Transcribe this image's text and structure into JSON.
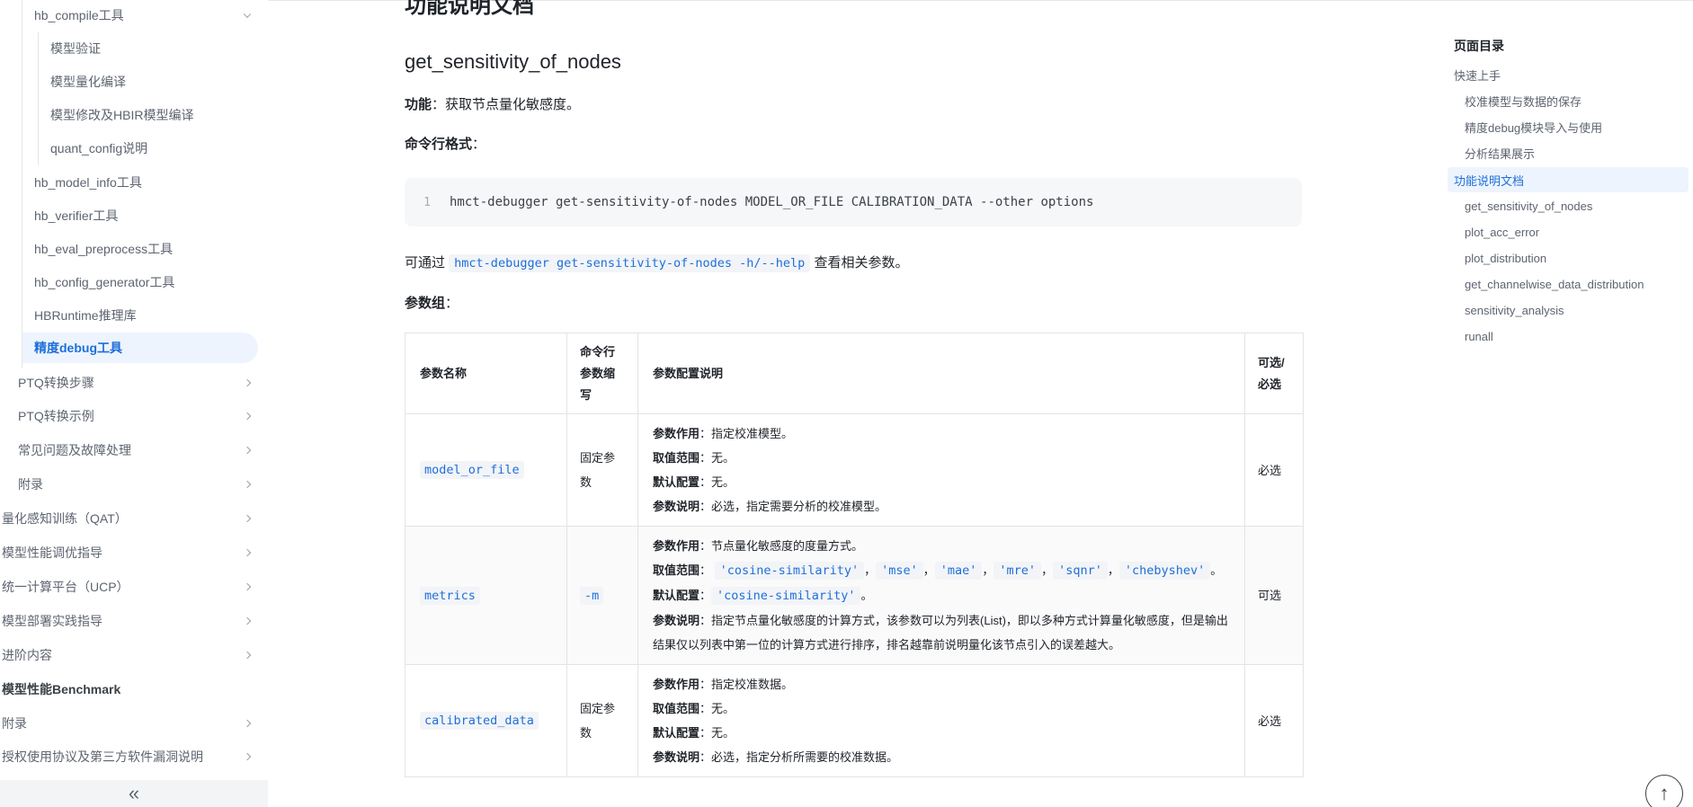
{
  "sidebar": {
    "items": [
      {
        "label": "hb_compile工具",
        "chevron": "down"
      },
      {
        "label": "模型验证"
      },
      {
        "label": "模型量化编译"
      },
      {
        "label": "模型修改及HBIR模型编译"
      },
      {
        "label": "quant_config说明"
      },
      {
        "label": "hb_model_info工具"
      },
      {
        "label": "hb_verifier工具"
      },
      {
        "label": "hb_eval_preprocess工具"
      },
      {
        "label": "hb_config_generator工具"
      },
      {
        "label": "HBRuntime推理库"
      },
      {
        "label": "精度debug工具",
        "active": true
      },
      {
        "label": "PTQ转换步骤",
        "chevron": "right"
      },
      {
        "label": "PTQ转换示例",
        "chevron": "right"
      },
      {
        "label": "常见问题及故障处理",
        "chevron": "right"
      },
      {
        "label": "附录",
        "chevron": "right"
      },
      {
        "label": "量化感知训练（QAT）",
        "chevron": "right"
      },
      {
        "label": "模型性能调优指导",
        "chevron": "right"
      },
      {
        "label": "统一计算平台（UCP）",
        "chevron": "right"
      },
      {
        "label": "模型部署实践指导",
        "chevron": "right"
      },
      {
        "label": "进阶内容",
        "chevron": "right"
      },
      {
        "label": "模型性能Benchmark"
      },
      {
        "label": "附录",
        "chevron": "right"
      },
      {
        "label": "授权使用协议及第三方软件漏洞说明",
        "chevron": "right"
      }
    ],
    "collapse_glyph": "«"
  },
  "main": {
    "cut_heading": "功能说明文档",
    "heading": "get_sensitivity_of_nodes",
    "function_label": "功能",
    "function_text": "：获取节点量化敏感度。",
    "cmd_format_label": "命令行格式",
    "cmd_format_colon": "：",
    "code_line_number": "1",
    "code_text": "hmct-debugger get-sensitivity-of-nodes MODEL_OR_FILE CALIBRATION_DATA --other options",
    "help_prefix": "可通过 ",
    "help_code": "hmct-debugger get-sensitivity-of-nodes -h/--help",
    "help_suffix": " 查看相关参数。",
    "params_label": "参数组",
    "params_colon": "：",
    "table": {
      "headers": [
        "参数名称",
        "命令行参数缩写",
        "参数配置说明",
        "可选/必选"
      ],
      "rows": [
        {
          "name": "model_or_file",
          "abbr": "固定参数",
          "role_label": "参数作用",
          "role": "：指定校准模型。",
          "range_label": "取值范围",
          "range": "：无。",
          "default_label": "默认配置",
          "default": "：无。",
          "note_label": "参数说明",
          "note": "：必选，指定需要分析的校准模型。",
          "required": "必选"
        },
        {
          "name": "metrics",
          "abbr": "-m",
          "role_label": "参数作用",
          "role": "：节点量化敏感度的度量方式。",
          "range_label": "取值范围",
          "range_prefix": "：",
          "range_options": [
            "'cosine-similarity'",
            "'mse'",
            "'mae'",
            "'mre'",
            "'sqnr'",
            "'chebyshev'"
          ],
          "range_end": "。",
          "default_label": "默认配置",
          "default_prefix": "：",
          "default_code": "'cosine-similarity'",
          "default_end": "。",
          "note_label": "参数说明",
          "note": "：指定节点量化敏感度的计算方式，该参数可以为列表(List)，即以多种方式计算量化敏感度，但是输出结果仅以列表中第一位的计算方式进行排序，排名越靠前说明量化该节点引入的误差越大。",
          "required": "可选"
        },
        {
          "name": "calibrated_data",
          "abbr": "固定参数",
          "role_label": "参数作用",
          "role": "：指定校准数据。",
          "range_label": "取值范围",
          "range": "：无。",
          "default_label": "默认配置",
          "default": "：无。",
          "note_label": "参数说明",
          "note": "：必选，指定分析所需要的校准数据。",
          "required": "必选"
        }
      ]
    }
  },
  "toc": {
    "title": "页面目录",
    "items": [
      {
        "label": "快速上手",
        "level": 1
      },
      {
        "label": "校准模型与数据的保存",
        "level": 2
      },
      {
        "label": "精度debug模块导入与使用",
        "level": 2
      },
      {
        "label": "分析结果展示",
        "level": 2
      },
      {
        "label": "功能说明文档",
        "level": 1,
        "active": true
      },
      {
        "label": "get_sensitivity_of_nodes",
        "level": 2
      },
      {
        "label": "plot_acc_error",
        "level": 2
      },
      {
        "label": "plot_distribution",
        "level": 2
      },
      {
        "label": "get_channelwise_data_distribution",
        "level": 2
      },
      {
        "label": "sensitivity_analysis",
        "level": 2
      },
      {
        "label": "runall",
        "level": 2
      }
    ]
  },
  "back_to_top_glyph": "↑",
  "colors": {
    "accent": "#1e6fd9",
    "active_bg": "#eef4fd",
    "code_bg": "#f6f7f9"
  }
}
